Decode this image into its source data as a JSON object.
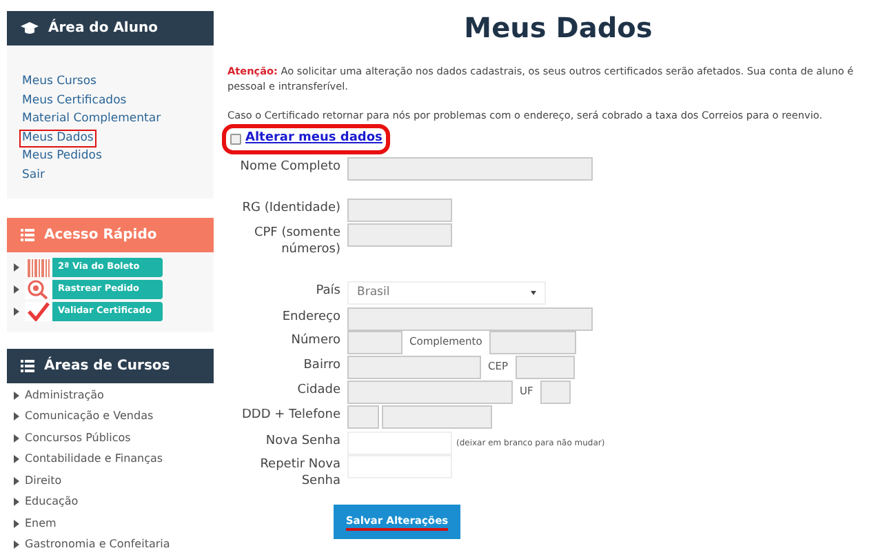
{
  "sidebar": {
    "student_area": {
      "title": "Área do Aluno",
      "items": [
        {
          "label": "Meus Cursos",
          "highlighted": false
        },
        {
          "label": "Meus Certificados",
          "highlighted": false
        },
        {
          "label": "Material Complementar",
          "highlighted": false
        },
        {
          "label": "Meus Dados",
          "highlighted": true
        },
        {
          "label": "Meus Pedidos",
          "highlighted": false
        },
        {
          "label": "Sair",
          "highlighted": false
        }
      ]
    },
    "quick_access": {
      "title": "Acesso Rápido",
      "items": [
        {
          "label": "2ª Via do Boleto",
          "kind": "barcode"
        },
        {
          "label": "Rastrear Pedido",
          "kind": "search"
        },
        {
          "label": "Validar Certificado",
          "kind": "check"
        }
      ]
    },
    "course_areas": {
      "title": "Áreas de Cursos",
      "items": [
        "Administração",
        "Comunicação e Vendas",
        "Concursos Públicos",
        "Contabilidade e Finanças",
        "Direito",
        "Educação",
        "Enem",
        "Gastronomia e Confeitaria"
      ]
    }
  },
  "main": {
    "title": "Meus Dados",
    "notice": "**Atenção:** Ao solicitar uma alteração nos dados cadastrais, os seus outros certificados serão afetados. Sua conta de aluno é pessoal e intransferível.",
    "info": "Caso o Certificado retornar para nós por problemas com o endereço, será cobrado a taxa dos Correios para o reenvio.",
    "edit_toggle": {
      "label": "Alterar meus dados",
      "checked": false,
      "highlighted": true
    },
    "form": [
      {
        "label": "Nome Completo",
        "kind": "wide",
        "disabled": true
      },
      {
        "label": "RG (Identidade)",
        "kind": "short",
        "disabled": true
      },
      {
        "label": "CPF (somente números)",
        "kind": "short",
        "disabled": true
      },
      {
        "label": "País",
        "kind": "select",
        "value": "Brasil",
        "disabled": false
      },
      {
        "label": "Endereço",
        "kind": "wide",
        "disabled": true
      },
      {
        "label": "Número",
        "kind": "pair",
        "sublabel": "Complemento",
        "disabled": true
      },
      {
        "label": "Bairro",
        "kind": "pair",
        "sublabel": "CEP",
        "disabled": true
      },
      {
        "label": "Cidade",
        "kind": "pair",
        "sublabel": "UF",
        "disabled": true
      },
      {
        "label": "DDD + Telefone",
        "kind": "phone",
        "disabled": true
      },
      {
        "label": "Nova Senha",
        "kind": "password",
        "hint": "(deixar em branco para não mudar)",
        "disabled": false
      },
      {
        "label": "Repetir Nova Senha",
        "kind": "password",
        "disabled": false
      }
    ],
    "submit": {
      "label": "Salvar Alterações",
      "underlined": true
    }
  }
}
